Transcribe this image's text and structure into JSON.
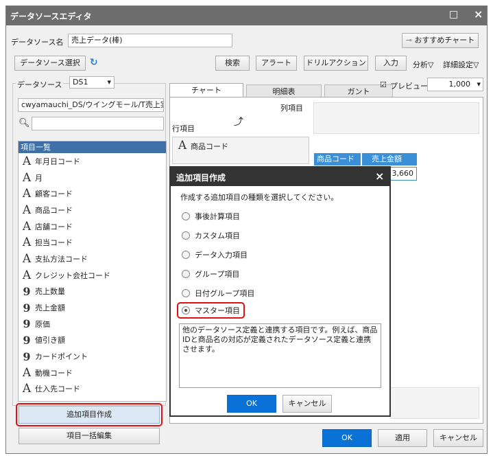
{
  "window": {
    "title": "データソースエディタ",
    "min_glyph": "□",
    "close_glyph": "×"
  },
  "ds_name": {
    "label": "データソース名",
    "value": "売上データ(棒)"
  },
  "recommend_button": "おすすめチャート",
  "toolbar": {
    "ds_select": "データソース選択",
    "search": "検索",
    "alert": "アラート",
    "drill": "ドリルアクション",
    "input": "入力",
    "analysis": "分析▽",
    "detail": "詳細設定▽"
  },
  "datasource": {
    "label": "データソース",
    "value": "DS1",
    "path": "cwyamauchi_DS/ウイングモール/T売上実"
  },
  "items": {
    "header": "項目一覧",
    "list": [
      {
        "icon": "A",
        "label": "年月日コード"
      },
      {
        "icon": "A",
        "label": "月"
      },
      {
        "icon": "A",
        "label": "顧客コード"
      },
      {
        "icon": "A",
        "label": "商品コード"
      },
      {
        "icon": "A",
        "label": "店舗コード"
      },
      {
        "icon": "A",
        "label": "担当コード"
      },
      {
        "icon": "A",
        "label": "支払方法コード"
      },
      {
        "icon": "A",
        "label": "クレジット会社コード"
      },
      {
        "icon": "9",
        "label": "売上数量"
      },
      {
        "icon": "9",
        "label": "売上金額"
      },
      {
        "icon": "9",
        "label": "原価"
      },
      {
        "icon": "9",
        "label": "値引き額"
      },
      {
        "icon": "9",
        "label": "カードポイント"
      },
      {
        "icon": "A",
        "label": "動機コード"
      },
      {
        "icon": "A",
        "label": "仕入先コード"
      }
    ]
  },
  "buttons": {
    "add_item": "追加項目作成",
    "bulk_edit": "項目一括編集",
    "ok": "OK",
    "apply": "適用",
    "cancel": "キャンセル"
  },
  "tabs": {
    "chart": "チャート",
    "detail": "明細表",
    "gantt": "ガント"
  },
  "preview": {
    "label": "プレビュー",
    "value": "1,000"
  },
  "layout": {
    "col_label": "列項目",
    "row_label": "行項目",
    "row_item": "商品コード"
  },
  "grid": {
    "h1": "商品コード",
    "h2": "売上金額",
    "cell": "3,660"
  },
  "dialog": {
    "title": "追加項目作成",
    "close": "×",
    "prompt": "作成する追加項目の種類を選択してください。",
    "options": [
      {
        "label": "事後計算項目",
        "selected": false
      },
      {
        "label": "カスタム項目",
        "selected": false
      },
      {
        "label": "データ入力項目",
        "selected": false
      },
      {
        "label": "グループ項目",
        "selected": false
      },
      {
        "label": "日付グループ項目",
        "selected": false
      },
      {
        "label": "マスター項目",
        "selected": true
      }
    ],
    "description": "他のデータソース定義と連携する項目です。例えば、商品IDと商品名の対応が定義されたデータソース定義と連携させます。",
    "ok": "OK",
    "cancel": "キャンセル"
  }
}
